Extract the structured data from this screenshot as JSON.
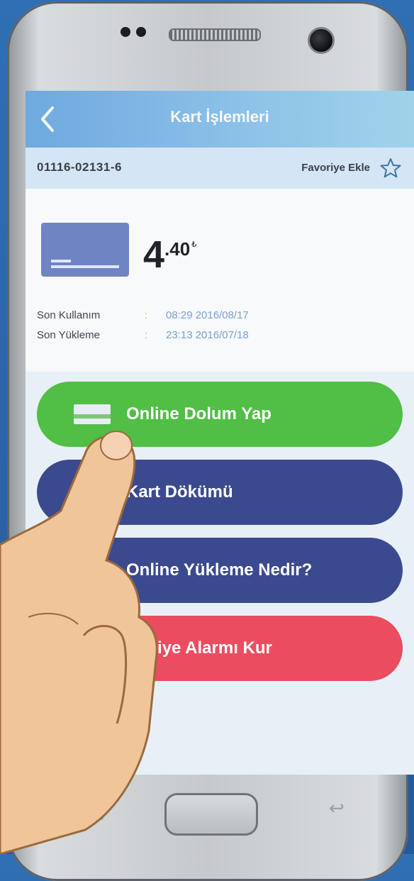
{
  "app": {
    "title": "Kart İşlemleri",
    "back_icon": "chevron-left-icon"
  },
  "card": {
    "number": "01116-02131-6",
    "favorite_label": "Favoriye Ekle",
    "favorite_icon": "star-outline-icon",
    "balance_int": "4",
    "balance_dec": ".40",
    "currency_symbol": "₺",
    "last_use_label": "Son Kullanım",
    "last_use_value": "08:29 2016/08/17",
    "last_load_label": "Son Yükleme",
    "last_load_value": "23:13 2016/07/18",
    "separator": ":"
  },
  "actions": [
    {
      "label": "Online Dolum Yap",
      "color": "#51be46",
      "icon": "credit-card-icon"
    },
    {
      "label": "Kart Dökümü",
      "color": "#3b4a8e",
      "icon": "document-icon"
    },
    {
      "label": "Online Yükleme Nedir?",
      "color": "#3b4a8e",
      "icon": "question-icon"
    },
    {
      "label": "Bakiye Alarmı Kur",
      "color": "#ea4d5f",
      "icon": "bell-icon"
    }
  ],
  "colors": {
    "appbar": "#6ea9e0",
    "background": "#2f6fb3"
  }
}
